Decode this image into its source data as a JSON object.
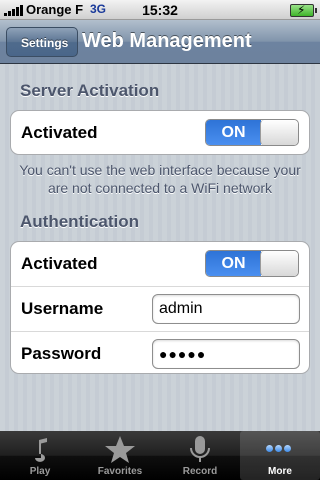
{
  "status_bar": {
    "carrier": "Orange F",
    "network": "3G",
    "time": "15:32"
  },
  "nav_bar": {
    "back_label": "Settings",
    "title": "Web Management"
  },
  "server_activation": {
    "header": "Server Activation",
    "activated_label": "Activated",
    "switch_state": "ON",
    "note": "You can't use the web interface because your are not connected to a WiFi network"
  },
  "authentication": {
    "header": "Authentication",
    "activated_label": "Activated",
    "switch_state": "ON",
    "username_label": "Username",
    "username_value": "admin",
    "password_label": "Password",
    "password_value": "●●●●●"
  },
  "tab_bar": {
    "tabs": [
      {
        "label": "Play",
        "icon": "note-icon"
      },
      {
        "label": "Favorites",
        "icon": "star-icon"
      },
      {
        "label": "Record",
        "icon": "microphone-icon"
      },
      {
        "label": "More",
        "icon": "more-icon"
      }
    ],
    "selected_index": 3
  },
  "colors": {
    "accent": "#2e73d6",
    "nav_bar": "#6d83a0",
    "section_header": "#4c566c"
  }
}
